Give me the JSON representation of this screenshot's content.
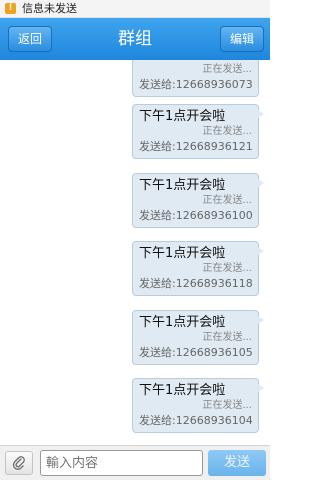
{
  "status_bar": {
    "warning_icon": "warning-icon",
    "text": "信息未发送"
  },
  "header": {
    "back_label": "返回",
    "title": "群组",
    "edit_label": "编辑"
  },
  "messages": [
    {
      "text": "",
      "status": "正在发送...",
      "to": "发送给:12668936073"
    },
    {
      "text": "下午1点开会啦",
      "status": "正在发送...",
      "to": "发送给:12668936121"
    },
    {
      "text": "下午1点开会啦",
      "status": "正在发送...",
      "to": "发送给:12668936100"
    },
    {
      "text": "下午1点开会啦",
      "status": "正在发送...",
      "to": "发送给:12668936118"
    },
    {
      "text": "下午1点开会啦",
      "status": "正在发送...",
      "to": "发送给:12668936105"
    },
    {
      "text": "下午1点开会啦",
      "status": "正在发送...",
      "to": "发送给:12668936104"
    }
  ],
  "compose": {
    "attach_icon": "paperclip-icon",
    "placeholder": "輸入内容",
    "send_label": "发送"
  },
  "colors": {
    "header": "#2b8fe3",
    "bubble": "#dfeaf3",
    "send_button": "#7bbcf0"
  }
}
